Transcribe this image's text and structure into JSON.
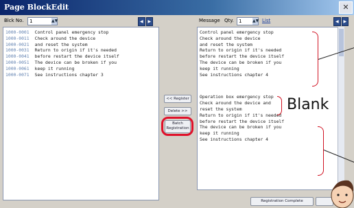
{
  "window": {
    "title": "Page BlockEdit",
    "close_glyph": "✕"
  },
  "left_toolbar": {
    "block_label": "Blck No.",
    "block_value": "1",
    "spin_glyph": "▲▼"
  },
  "right_toolbar": {
    "message_label": "Message",
    "qty_label": "Qty.",
    "qty_value": "1",
    "link_label": "List"
  },
  "nav_glyphs": {
    "prev": "◀",
    "next": "▶"
  },
  "left_lines": [
    {
      "code": "1000-0001",
      "text": "Control panel emergency stop"
    },
    {
      "code": "1000-0011",
      "text": "Check around the device"
    },
    {
      "code": "1000-0021",
      "text": "and reset the system"
    },
    {
      "code": "1000-0031",
      "text": "Return to origin if it's needed"
    },
    {
      "code": "1000-0041",
      "text": "before restart the device itself"
    },
    {
      "code": "1000-0051",
      "text": "The device can be broken if you"
    },
    {
      "code": "1000-0061",
      "text": "keep it running"
    },
    {
      "code": "1000-0071",
      "text": "See instructions chapter 3"
    }
  ],
  "right_top_lines": [
    "Control panel emergency stop",
    "Check around the device",
    "and reset the system",
    "Return to origin if it's needed",
    "before restart the device itself",
    "The device can be broken if you",
    "keep it running",
    "See instructions chapter 4"
  ],
  "right_bottom_lines": [
    "Operation box emergency stop",
    "Check around the device and",
    "reset the system",
    "Return to origin if it's needed",
    "before restart the device itself",
    "The device can be broken if you",
    "keep it running",
    "See instructions chapter 4"
  ],
  "middle_buttons": {
    "register": "<< Register",
    "delete": "Delete >>",
    "batch_line1": "Batch",
    "batch_line2": "Registration"
  },
  "bottom_buttons": {
    "registration_complete": "Registration Complete"
  },
  "annotation": {
    "label": "Blank"
  },
  "colors": {
    "accent_red": "#e0102a",
    "title_blue": "#0a246a"
  }
}
